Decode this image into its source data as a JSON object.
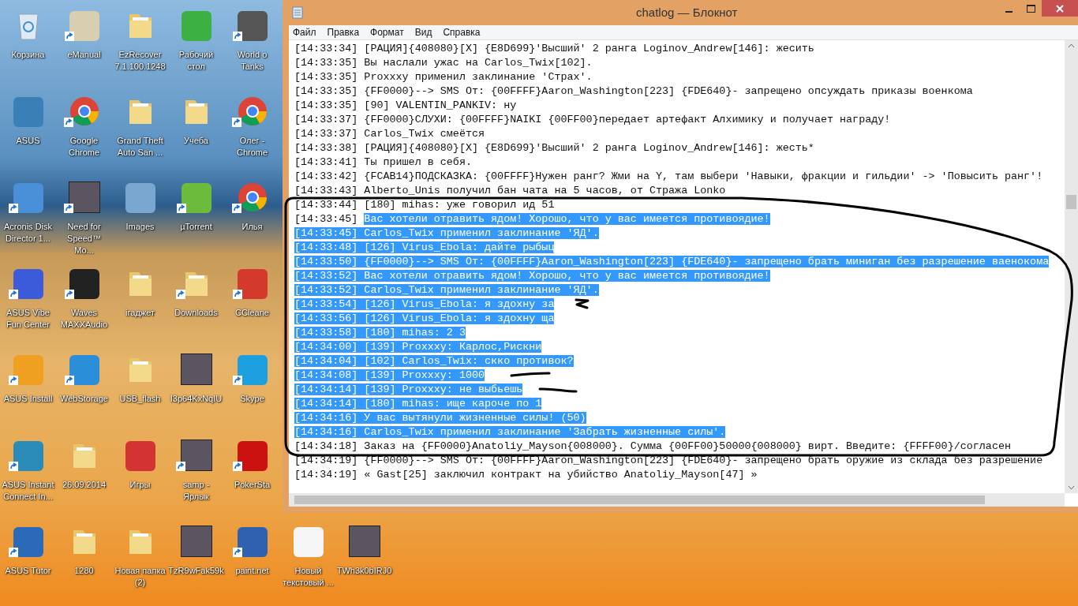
{
  "desktop": {
    "rows": [
      [
        {
          "label": "Корзина",
          "kind": "recycle-bin",
          "shortcut": false
        },
        {
          "label": "eManual",
          "kind": "app",
          "color": "#d8cfb0",
          "shortcut": true
        },
        {
          "label": "EzRecover 7.1.100.1248",
          "kind": "folder",
          "shortcut": false
        },
        {
          "label": "Рабочий стол",
          "kind": "app",
          "color": "#3cb043",
          "shortcut": false
        },
        {
          "label": "World o Tanks",
          "kind": "app",
          "color": "#555555",
          "shortcut": true
        }
      ],
      [
        {
          "label": "ASUS",
          "kind": "app",
          "color": "#3a7fb5",
          "shortcut": false
        },
        {
          "label": "Google Chrome",
          "kind": "chrome",
          "shortcut": true
        },
        {
          "label": "Grand Theft Auto San ...",
          "kind": "folder",
          "shortcut": false
        },
        {
          "label": "Учеба",
          "kind": "folder",
          "shortcut": false
        },
        {
          "label": "Олег - Chrome",
          "kind": "chrome",
          "shortcut": true
        }
      ],
      [
        {
          "label": "Acronis Disk Director 1...",
          "kind": "app",
          "color": "#4a90d9",
          "shortcut": true
        },
        {
          "label": "Need for Speed™ Mo...",
          "kind": "photo",
          "shortcut": true
        },
        {
          "label": "Images",
          "kind": "app",
          "color": "#7aa7d0",
          "shortcut": false
        },
        {
          "label": "µTorrent",
          "kind": "app",
          "color": "#6dbb3c",
          "shortcut": true
        },
        {
          "label": "Илья",
          "kind": "chrome",
          "shortcut": true
        }
      ],
      [
        {
          "label": "ASUS Vibe Fun Center",
          "kind": "app",
          "color": "#3b5bdb",
          "shortcut": true
        },
        {
          "label": "Waves MAXXAudio",
          "kind": "app",
          "color": "#222222",
          "shortcut": true
        },
        {
          "label": "iгаджет",
          "kind": "folder",
          "shortcut": false
        },
        {
          "label": "Downloads",
          "kind": "folder",
          "shortcut": true
        },
        {
          "label": "CCleane",
          "kind": "app",
          "color": "#d33a2c",
          "shortcut": true
        }
      ],
      [
        {
          "label": "ASUS Install",
          "kind": "app",
          "color": "#f0a020",
          "shortcut": true
        },
        {
          "label": "WebStorage",
          "kind": "app",
          "color": "#2a8fd8",
          "shortcut": true
        },
        {
          "label": "USB_flash",
          "kind": "folder",
          "shortcut": false
        },
        {
          "label": "I3p64KxNqIU",
          "kind": "photo",
          "shortcut": false
        },
        {
          "label": "Skype",
          "kind": "app",
          "color": "#1ea0e0",
          "shortcut": true
        }
      ],
      [
        {
          "label": "ASUS Instant Connect In...",
          "kind": "app",
          "color": "#2a8ab8",
          "shortcut": true
        },
        {
          "label": "26.09.2014",
          "kind": "folder",
          "shortcut": false
        },
        {
          "label": "Игры",
          "kind": "app",
          "color": "#d33333",
          "shortcut": false
        },
        {
          "label": "samp - Ярлык",
          "kind": "photo",
          "shortcut": true
        },
        {
          "label": "PokerSta",
          "kind": "app",
          "color": "#cc1111",
          "shortcut": true
        }
      ],
      [
        {
          "label": "ASUS Tutor",
          "kind": "app",
          "color": "#2a6ab8",
          "shortcut": true
        },
        {
          "label": "1280",
          "kind": "folder",
          "shortcut": false
        },
        {
          "label": "Новая папка (2)",
          "kind": "folder",
          "shortcut": false
        },
        {
          "label": "TzR9wFak59k",
          "kind": "photo",
          "shortcut": false
        },
        {
          "label": "paint.net",
          "kind": "app",
          "color": "#3060b0",
          "shortcut": true
        },
        {
          "label": "Новый текстовый ...",
          "kind": "app",
          "color": "#f5f5f5",
          "shortcut": false
        },
        {
          "label": "TWh3k0bIRJ0",
          "kind": "photo",
          "shortcut": false
        }
      ]
    ]
  },
  "window": {
    "title": "chatlog — Блокнот",
    "menu": [
      "Файл",
      "Правка",
      "Формат",
      "Вид",
      "Справка"
    ],
    "lines": [
      {
        "time": "[14:33:34]",
        "text": "[РАЦИЯ]{408080}[X] {E8D699}'Высший' 2 ранга Loginov_Andrew[146]: жесить",
        "selected": false
      },
      {
        "time": "[14:33:35]",
        "text": "Вы наслали ужас на Carlos_Twix[102].",
        "selected": false
      },
      {
        "time": "[14:33:35]",
        "text": "Proxxxy применил заклинание 'Страх'.",
        "selected": false
      },
      {
        "time": "[14:33:35]",
        "text": "{FF0000}--> SMS От: {00FFFF}Aaron_Washington[223] {FDE640}- запрещено опсуждать приказы военкома",
        "selected": false
      },
      {
        "time": "[14:33:35]",
        "text": "[90] VALENTIN_PANKIV: ну",
        "selected": false
      },
      {
        "time": "[14:33:37]",
        "text": "{FF0000}СЛУХИ: {00FFFF}NAIKI {00FF00}передает артефакт Алхимику и получает награду!",
        "selected": false
      },
      {
        "time": "[14:33:37]",
        "text": "Carlos_Twix смеётся",
        "selected": false
      },
      {
        "time": "[14:33:38]",
        "text": "[РАЦИЯ]{408080}[X] {E8D699}'Высший' 2 ранга Loginov_Andrew[146]: жесть*",
        "selected": false
      },
      {
        "time": "[14:33:41]",
        "text": "Ты пришел в себя.",
        "selected": false
      },
      {
        "time": "[14:33:42]",
        "text": "{FCAB14}ПОДСКАЗКА: {00FFFF}Нужен ранг? Жми на Y, там выбери 'Навыки, фракции и гильдии' -> 'Повысить ранг'!",
        "selected": false
      },
      {
        "time": "[14:33:43]",
        "text": "Alberto_Unis получил бан чата на 5 часов, от Стража Lonko",
        "selected": false
      },
      {
        "time": "[14:33:44]",
        "text": "[180] mihas: уже говорил ид 51",
        "selected": false
      },
      {
        "time": "[14:33:45]",
        "text": "Вас хотели отравить ядом! Хорошо, что у вас имеется противоядие!",
        "time_selected": false,
        "selected": true
      },
      {
        "time": "[14:33:45]",
        "text": "Carlos_Twix применил заклинание 'ЯД'.",
        "selected": true
      },
      {
        "time": "[14:33:48]",
        "text": "[126] Virus_Ebola: дайте рыбыц",
        "selected": true
      },
      {
        "time": "[14:33:50]",
        "text": "{FF0000}--> SMS От: {00FFFF}Aaron_Washington[223] {FDE640}- запрещено брать миниган без разрешение ваенокома",
        "selected": true
      },
      {
        "time": "[14:33:52]",
        "text": "Вас хотели отравить ядом! Хорошо, что у вас имеется противоядие!",
        "selected": true
      },
      {
        "time": "[14:33:52]",
        "text": "Carlos_Twix применил заклинание 'ЯД'.",
        "selected": true
      },
      {
        "time": "[14:33:54]",
        "text": "[126] Virus_Ebola: я здохну за",
        "selected": true
      },
      {
        "time": "[14:33:56]",
        "text": "[126] Virus_Ebola: я здохну ща",
        "selected": true
      },
      {
        "time": "[14:33:58]",
        "text": "[180] mihas: 2 3",
        "selected": true
      },
      {
        "time": "[14:34:00]",
        "text": "[139] Proxxxy: Карлос,Рискни",
        "selected": true
      },
      {
        "time": "[14:34:04]",
        "text": "[102] Carlos_Twix: скко противок?",
        "selected": true
      },
      {
        "time": "[14:34:08]",
        "text": "[139] Proxxxy: 1000",
        "selected": true
      },
      {
        "time": "[14:34:14]",
        "text": "[139] Proxxxy: не выбьешь",
        "selected": true
      },
      {
        "time": "[14:34:14]",
        "text": "[180] mihas: ище кароче по 1",
        "selected": true
      },
      {
        "time": "[14:34:16]",
        "text": "У вас вытянули жизненные силы! (50)",
        "selected": true
      },
      {
        "time": "[14:34:16]",
        "text": "Carlos_Twix применил заклинание 'Забрать жизненные силы'.",
        "selected": true
      },
      {
        "time": "[14:34:18]",
        "text": "Заказ на {FF0000}Anatoliy_Mayson{008000}. Сумма {00FF00}50000{008000} вирт. Введите: {FFFF00}/согласен",
        "selected": false
      },
      {
        "time": "[14:34:19]",
        "text": "{FF0000}--> SMS От: {00FFFF}Aaron_Washington[223] {FDE640}- запрещено брать оружие из склада без разрешение",
        "selected": false
      },
      {
        "time": "[14:34:19]",
        "text": "« Gast[25] заключил контракт на убийство Anatoliy_Mayson[47] »",
        "selected": false
      }
    ]
  }
}
